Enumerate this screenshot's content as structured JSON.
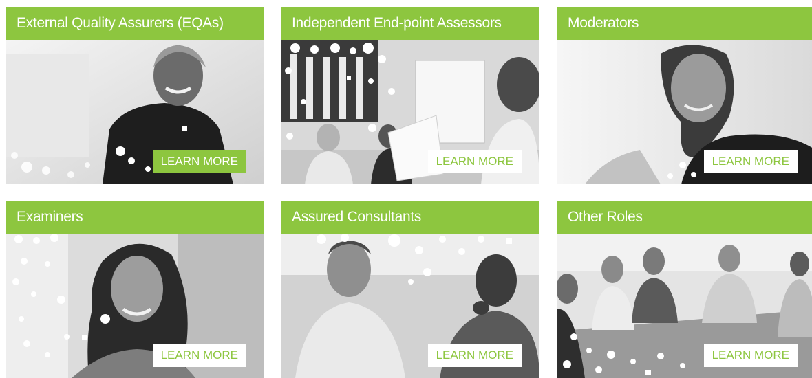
{
  "colors": {
    "accent": "#8dc63f",
    "button_text_active": "#ffffff",
    "button_bg": "#ffffff"
  },
  "cards": [
    {
      "title": "External Quality Assurers (EQAs)",
      "button": "LEARN MORE",
      "button_state": "active",
      "photo_icon": "smiling-woman-photo"
    },
    {
      "title": "Independent End-point Assessors",
      "button": "LEARN MORE",
      "button_state": "default",
      "photo_icon": "office-meeting-photo"
    },
    {
      "title": "Moderators",
      "button": "LEARN MORE",
      "button_state": "default",
      "photo_icon": "woman-with-braid-photo"
    },
    {
      "title": "Examiners",
      "button": "LEARN MORE",
      "button_state": "default",
      "photo_icon": "smiling-woman-photo"
    },
    {
      "title": "Assured Consultants",
      "button": "LEARN MORE",
      "button_state": "default",
      "photo_icon": "two-men-photo"
    },
    {
      "title": "Other Roles",
      "button": "LEARN MORE",
      "button_state": "default",
      "photo_icon": "group-meeting-photo"
    }
  ]
}
